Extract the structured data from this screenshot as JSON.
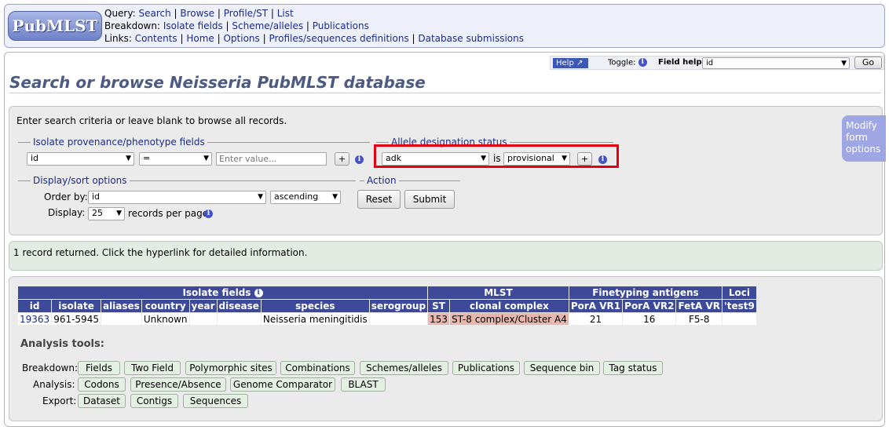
{
  "logo": "PubMLST",
  "nav": {
    "query_label": "Query:",
    "query_links": [
      "Search",
      "Browse",
      "Profile/ST",
      "List"
    ],
    "breakdown_label": "Breakdown:",
    "breakdown_links": [
      "Isolate fields",
      "Scheme/alleles",
      "Publications"
    ],
    "links_label": "Links:",
    "links_links": [
      "Contents",
      "Home",
      "Options",
      "Profiles/sequences definitions",
      "Database submissions"
    ]
  },
  "toolbar": {
    "help": "Help",
    "toggle": "Toggle:",
    "field_help_label": "Field help:",
    "field_help_value": "id",
    "go": "Go"
  },
  "title": "Search or browse Neisseria PubMLST database",
  "form": {
    "intro": "Enter search criteria or leave blank to browse all records.",
    "provenance_legend": "Isolate provenance/phenotype fields",
    "prov_field": "id",
    "prov_op": "=",
    "prov_placeholder": "Enter value...",
    "allele_legend": "Allele designation status",
    "allele_locus": "adk",
    "allele_is": "is",
    "allele_status": "provisional",
    "display_legend": "Display/sort options",
    "order_by_label": "Order by:",
    "order_by_value": "id",
    "order_dir": "ascending",
    "display_label": "Display:",
    "display_value": "25",
    "records_per_page": "records per page",
    "action_legend": "Action",
    "reset": "Reset",
    "submit": "Submit",
    "plus": "+"
  },
  "modify": [
    "Modify",
    "form",
    "options"
  ],
  "result_text": "1 record returned. Click the hyperlink for detailed information.",
  "table": {
    "groups": {
      "isolate": "Isolate fields",
      "mlst": "MLST",
      "fine": "Finetyping antigens",
      "loci": "Loci"
    },
    "headers": [
      "id",
      "isolate",
      "aliases",
      "country",
      "year",
      "disease",
      "species",
      "serogroup",
      "ST",
      "clonal complex",
      "PorA VR1",
      "PorA VR2",
      "FetA VR",
      "'test9"
    ],
    "row": [
      "19363",
      "961-5945",
      "",
      "Unknown",
      "",
      "",
      "Neisseria meningitidis",
      "",
      "153",
      "ST-8 complex/Cluster A4",
      "21",
      "16",
      "F5-8",
      ""
    ]
  },
  "analysis": {
    "heading": "Analysis tools:",
    "breakdown_label": "Breakdown:",
    "breakdown": [
      "Fields",
      "Two Field",
      "Polymorphic sites",
      "Combinations",
      "Schemes/alleles",
      "Publications",
      "Sequence bin",
      "Tag status"
    ],
    "analysis_label": "Analysis:",
    "analysis": [
      "Codons",
      "Presence/Absence",
      "Genome Comparator",
      "BLAST"
    ],
    "export_label": "Export:",
    "export": [
      "Dataset",
      "Contigs",
      "Sequences"
    ]
  }
}
